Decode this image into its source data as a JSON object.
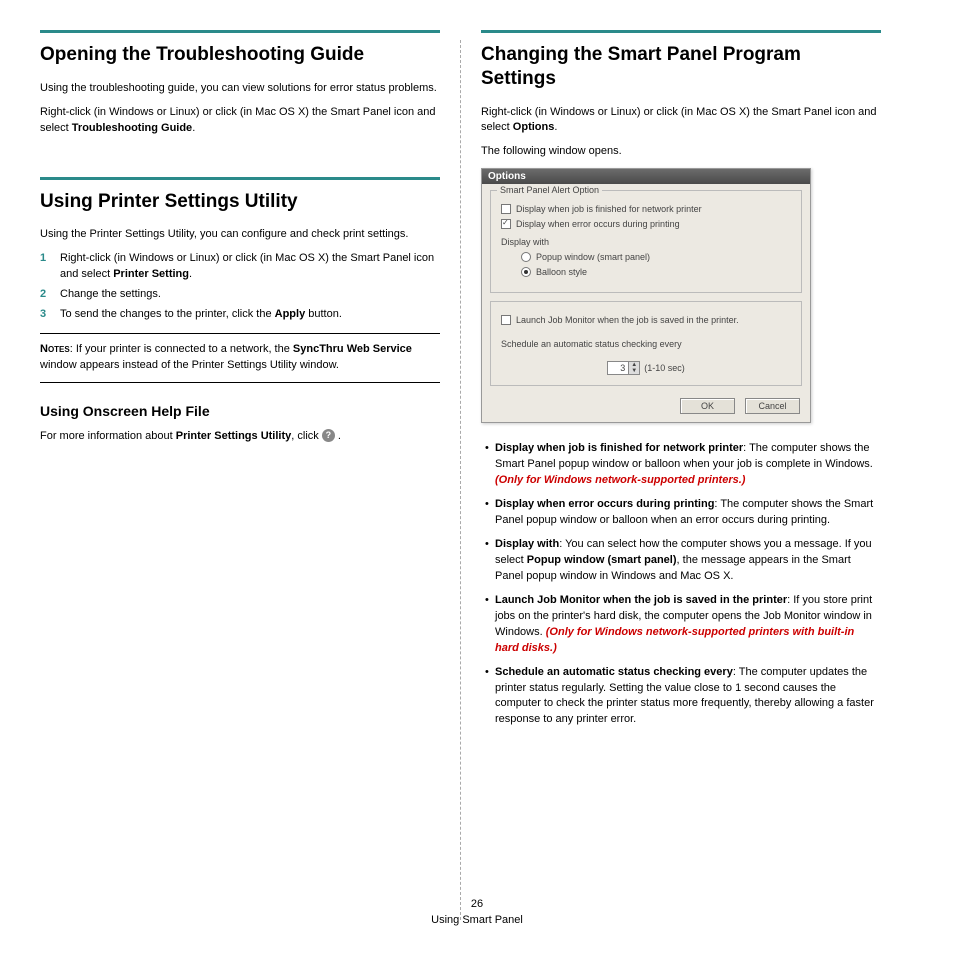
{
  "footer": {
    "page_num": "26",
    "section": "Using Smart Panel"
  },
  "left": {
    "h_troubleshoot": "Opening the Troubleshooting Guide",
    "p_trouble_1": "Using the troubleshooting guide, you can view solutions for error status problems.",
    "p_trouble_2a": "Right-click (in Windows or Linux) or click (in Mac OS X) the Smart Panel icon and select ",
    "p_trouble_2b": "Troubleshooting Guide",
    "p_trouble_2c": ".",
    "h_utility": "Using Printer Settings Utility",
    "p_util_1": "Using the Printer Settings Utility, you can configure and check print settings.",
    "ol": [
      {
        "num": "1",
        "a": "Right-click (in Windows or Linux) or click (in Mac OS X) the Smart Panel icon and select ",
        "b": "Printer Setting",
        "c": "."
      },
      {
        "num": "2",
        "a": "Change the settings.",
        "b": "",
        "c": ""
      },
      {
        "num": "3",
        "a": "To send the changes to the printer, click the ",
        "b": "Apply",
        "c": " button."
      }
    ],
    "notes_label": "Notes",
    "notes_a": ": If your printer is connected to a network, the ",
    "notes_b": "SyncThru Web Service",
    "notes_c": " window appears instead of the Printer Settings Utility window.",
    "h_help": "Using Onscreen Help File",
    "help_a": "For more information about ",
    "help_b": "Printer Settings Utility",
    "help_c": ", click ",
    "help_icon": "?",
    "help_d": " ."
  },
  "right": {
    "h_change": "Changing the Smart Panel Program Settings",
    "p_change_1a": "Right-click (in Windows or Linux) or click (in Mac OS X) the Smart Panel icon and select ",
    "p_change_1b": "Options",
    "p_change_1c": ".",
    "p_change_2": "The following window opens.",
    "dialog": {
      "title": "Options",
      "fs1_legend": "Smart Panel Alert Option",
      "cb1": "Display when job is finished for network printer",
      "cb2": "Display when error occurs during printing",
      "display_with": "Display with",
      "rb1": "Popup window (smart panel)",
      "rb2": "Balloon style",
      "cb3": "Launch Job Monitor when the job is saved in the printer.",
      "sched": "Schedule an automatic status checking every",
      "sched_val": "3",
      "sched_unit": "(1-10 sec)",
      "ok": "OK",
      "cancel": "Cancel"
    },
    "bullets": [
      {
        "t": "Display when job is finished for network printer",
        "body": ": The computer shows the Smart Panel popup window or balloon when your job is complete in Windows. ",
        "red": "(Only for Windows network-supported printers.)"
      },
      {
        "t": "Display when error occurs during printing",
        "body": ": The computer shows the Smart Panel popup window or balloon when an error occurs during printing.",
        "red": ""
      },
      {
        "t": "Display with",
        "body": ": You can select how the computer shows you a message. If you select ",
        "mid_b": "Popup window (smart panel)",
        "body2": ", the message appears in the Smart Panel popup window in Windows and Mac OS X.",
        "red": ""
      },
      {
        "t": "Launch Job Monitor when the job is saved in the printer",
        "body": ": If you store print jobs on the printer's hard disk, the computer opens the Job Monitor window in Windows. ",
        "red": "(Only for Windows network-supported printers with built-in hard disks.)"
      },
      {
        "t": "Schedule an automatic status checking every",
        "body": ": The computer updates the printer status regularly. Setting the value close to 1 second causes the computer to check the printer status more frequently, thereby allowing a faster response to any printer error.",
        "red": ""
      }
    ]
  }
}
